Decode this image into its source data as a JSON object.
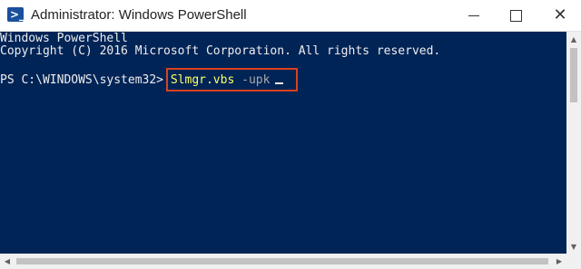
{
  "window": {
    "title": "Administrator: Windows PowerShell",
    "icon": "powershell-icon",
    "controls": [
      "minimize-icon",
      "maximize-icon",
      "close-icon"
    ]
  },
  "console": {
    "lines": [
      "Windows PowerShell",
      "Copyright (C) 2016 Microsoft Corporation. All rights reserved."
    ],
    "prompt": "PS C:\\WINDOWS\\system32> ",
    "command": "Slmgr.vbs",
    "argument": " -upk",
    "colors": {
      "background": "#012456",
      "text": "#eeedf0",
      "command": "#ffff66",
      "argument": "#a9a9a9",
      "highlight_box": "#d9421f"
    }
  }
}
